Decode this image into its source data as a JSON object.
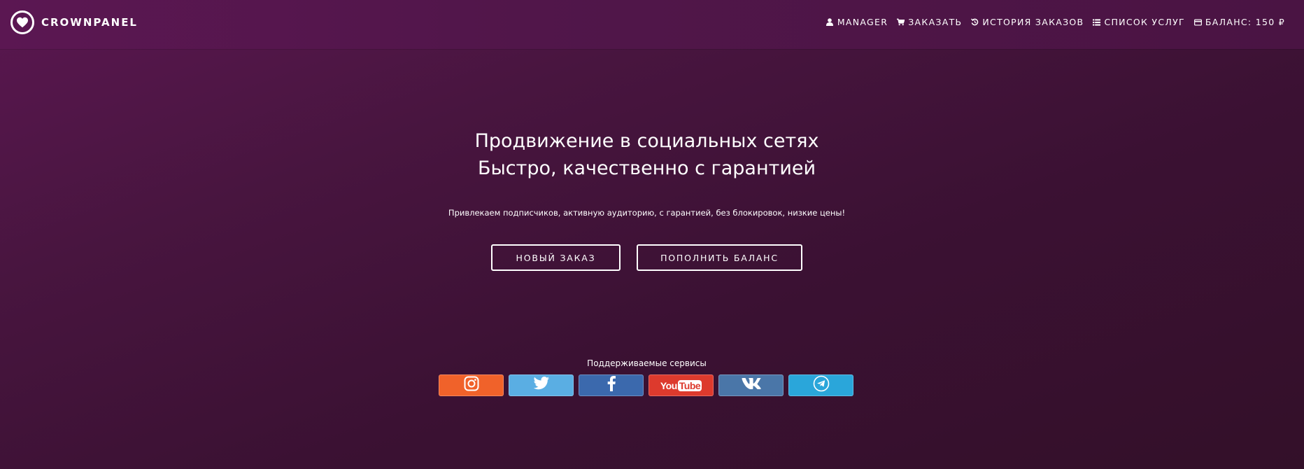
{
  "header": {
    "brand": "CROWNPANEL",
    "nav": [
      {
        "label": "MANAGER",
        "icon": "user-icon"
      },
      {
        "label": "ЗАКАЗАТЬ",
        "icon": "cart-icon"
      },
      {
        "label": "ИСТОРИЯ ЗАКАЗОВ",
        "icon": "history-icon"
      },
      {
        "label": "СПИСОК УСЛУГ",
        "icon": "list-icon"
      },
      {
        "label": "БАЛАНС: 150 ₽",
        "icon": "credit-card-icon"
      }
    ]
  },
  "hero": {
    "title_line1": "Продвижение в социальных сетях",
    "title_line2": "Быстро, качественно с гарантией",
    "subtitle": "Привлекаем подписчиков, активную аудиторию, с гарантией, без блокировок, низкие цены!",
    "new_order_label": "НОВЫЙ ЗАКАЗ",
    "topup_label": "ПОПОЛНИТЬ БАЛАНС"
  },
  "services": {
    "label": "Поддерживаемые сервисы",
    "items": [
      {
        "name": "instagram",
        "icon": "instagram-icon",
        "color": "#f0622a"
      },
      {
        "name": "twitter",
        "icon": "twitter-icon",
        "color": "#5aaee3"
      },
      {
        "name": "facebook",
        "icon": "facebook-icon",
        "color": "#3b69ad"
      },
      {
        "name": "youtube",
        "icon": "youtube-icon",
        "color": "#dd3a2d",
        "text_you": "You",
        "text_tube": "Tube"
      },
      {
        "name": "vk",
        "icon": "vk-icon",
        "color": "#4a76a8"
      },
      {
        "name": "telegram",
        "icon": "telegram-icon",
        "color": "#2aa6da"
      }
    ]
  },
  "colors": {
    "background": "#3b1133",
    "header": "#541649",
    "text": "#ffffff"
  }
}
